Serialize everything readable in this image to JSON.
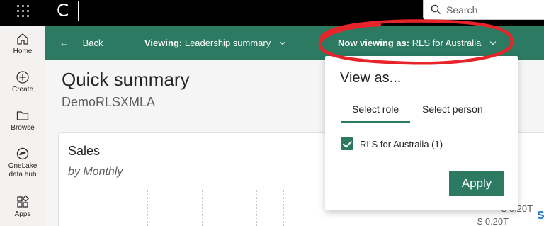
{
  "topbar": {
    "search_placeholder": "Search"
  },
  "leftnav": {
    "items": [
      {
        "label": "Home",
        "icon": "home-icon"
      },
      {
        "label": "Create",
        "icon": "plus-circle-icon"
      },
      {
        "label": "Browse",
        "icon": "folder-icon"
      },
      {
        "label": "OneLake\ndata hub",
        "label_line1": "OneLake",
        "label_line2": "data hub",
        "icon": "onelake-icon"
      },
      {
        "label": "Apps",
        "icon": "apps-icon"
      }
    ]
  },
  "actionbar": {
    "back_label": "Back",
    "viewing_prefix": "Viewing:",
    "viewing_value": "Leadership summary",
    "now_viewing_prefix": "Now viewing as:",
    "now_viewing_value": "RLS for Australia"
  },
  "page": {
    "title": "Quick summary",
    "subtitle": "DemoRLSXMLA"
  },
  "card": {
    "title": "Sales",
    "subtitle": "by Monthly",
    "y_ticks": [
      "$ 0.20T",
      "$ 0.20T"
    ]
  },
  "view_as_panel": {
    "title": "View as...",
    "tabs": [
      "Select role",
      "Select person"
    ],
    "active_tab": "Select role",
    "roles": [
      {
        "label": "RLS for Australia (1)",
        "checked": true
      }
    ],
    "apply_label": "Apply"
  },
  "colors": {
    "accent": "#2b7a61",
    "annotation": "#e8242b"
  }
}
